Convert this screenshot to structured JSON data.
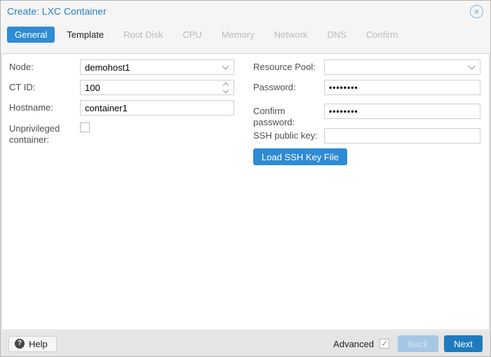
{
  "window": {
    "title": "Create: LXC Container",
    "close_icon": "circle-x-icon"
  },
  "tabs": [
    {
      "label": "General",
      "state": "active"
    },
    {
      "label": "Template",
      "state": "enabled"
    },
    {
      "label": "Root Disk",
      "state": "disabled"
    },
    {
      "label": "CPU",
      "state": "disabled"
    },
    {
      "label": "Memory",
      "state": "disabled"
    },
    {
      "label": "Network",
      "state": "disabled"
    },
    {
      "label": "DNS",
      "state": "disabled"
    },
    {
      "label": "Confirm",
      "state": "disabled"
    }
  ],
  "form": {
    "left": {
      "node": {
        "label": "Node:",
        "type": "combobox",
        "value": "demohost1"
      },
      "ctid": {
        "label": "CT ID:",
        "type": "spinner",
        "value": "100"
      },
      "hostname": {
        "label": "Hostname:",
        "type": "text",
        "value": "container1"
      },
      "unprivileged": {
        "label": "Unprivileged container:",
        "type": "checkbox",
        "checked": false
      }
    },
    "right": {
      "resource_pool": {
        "label": "Resource Pool:",
        "type": "combobox",
        "value": ""
      },
      "password": {
        "label": "Password:",
        "type": "password",
        "value": "••••••••"
      },
      "confirm_password": {
        "label": "Confirm password:",
        "type": "password",
        "value": "••••••••"
      },
      "ssh_public_key": {
        "label": "SSH public key:",
        "type": "text",
        "value": ""
      },
      "load_ssh_button": {
        "label": "Load SSH Key File"
      }
    }
  },
  "footer": {
    "help_label": "Help",
    "help_icon": "?",
    "advanced_label": "Advanced",
    "advanced_checked": true,
    "back_label": "Back",
    "next_label": "Next"
  },
  "colors": {
    "accent_blue": "#2e8bd4",
    "next_button_blue": "#1e7bbf",
    "back_button_disabled": "#a5c7e5",
    "title_blue": "#2b7fc4",
    "header_bg": "#f5f5f5",
    "footer_bg": "#e5e5e5"
  }
}
